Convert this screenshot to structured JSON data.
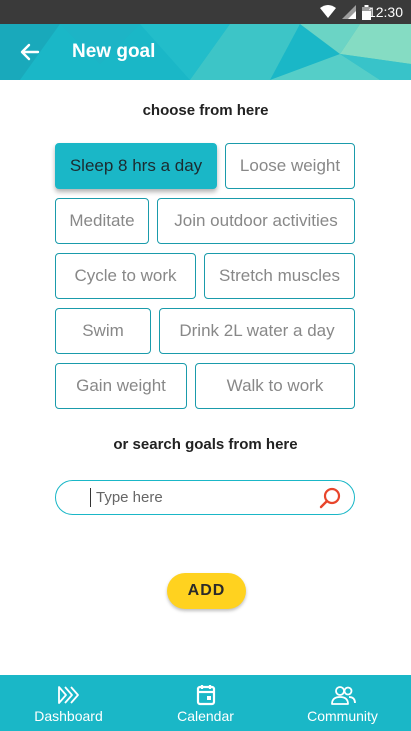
{
  "status_bar": {
    "time": "12:30"
  },
  "header": {
    "title": "New goal"
  },
  "choose": {
    "title": "choose from here",
    "goals": [
      "Sleep 8 hrs a day",
      "Loose weight",
      "Meditate",
      "Join outdoor activities",
      "Cycle to work",
      "Stretch muscles",
      "Swim",
      "Drink 2L water a day",
      "Gain weight",
      "Walk to work"
    ],
    "selected": "Sleep 8 hrs a day"
  },
  "search": {
    "title": "or search goals from here",
    "placeholder": "Type here",
    "value": ""
  },
  "add_label": "ADD",
  "nav": {
    "items": [
      {
        "label": "Dashboard",
        "icon": "dashboard-icon"
      },
      {
        "label": "Calendar",
        "icon": "calendar-icon"
      },
      {
        "label": "Community",
        "icon": "community-icon"
      }
    ]
  },
  "colors": {
    "primary": "#1ab7c7",
    "chip_border": "#1a9bab",
    "accent_yellow": "#ffd21f",
    "search_icon": "#e8452c",
    "status_bar": "#3a3a3a"
  }
}
